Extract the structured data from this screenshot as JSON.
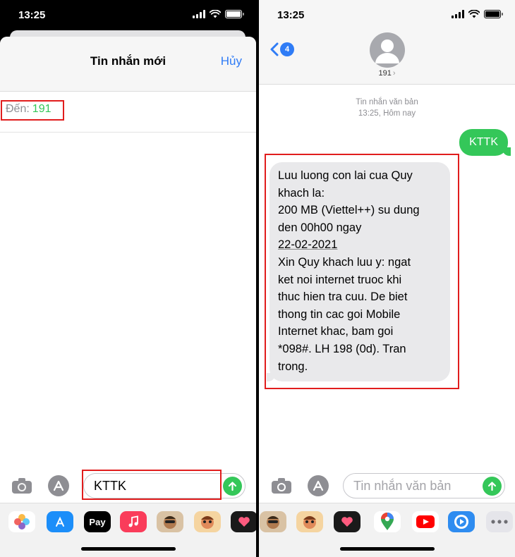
{
  "status": {
    "time": "13:25"
  },
  "left": {
    "sheet_title": "Tin nhắn mới",
    "cancel_label": "Hủy",
    "to_label": "Đến:",
    "to_value": "191",
    "composer_text": "KTTK"
  },
  "right": {
    "back_count": "4",
    "contact_name": "191",
    "chevron": "›",
    "meta_kind": "Tin nhắn văn bản",
    "meta_time": "13:25, Hôm nay",
    "sent_message": "KTTK",
    "received_lines": [
      "Luu luong con lai cua Quy",
      "khach la:",
      "200 MB (Viettel++) su dung",
      "den 00h00 ngay",
      "22-02-2021",
      "Xin Quy khach luu y: ngat",
      "ket noi internet truoc khi",
      "thuc hien tra cuu. De biet",
      "thong tin cac goi Mobile",
      "Internet khac, bam goi",
      "*098#. LH 198 (0d). Tran",
      "trong."
    ],
    "composer_placeholder": "Tin nhắn văn bản"
  },
  "icons": {
    "camera": "camera-icon",
    "appstore": "app-store-icon",
    "send": "send-arrow-icon"
  },
  "apple_pay_label": "Pay",
  "colors": {
    "accent_blue": "#2f7cf6",
    "imessage_green": "#34c759",
    "highlight_red": "#e11d1d",
    "bubble_gray": "#e9e9eb"
  }
}
